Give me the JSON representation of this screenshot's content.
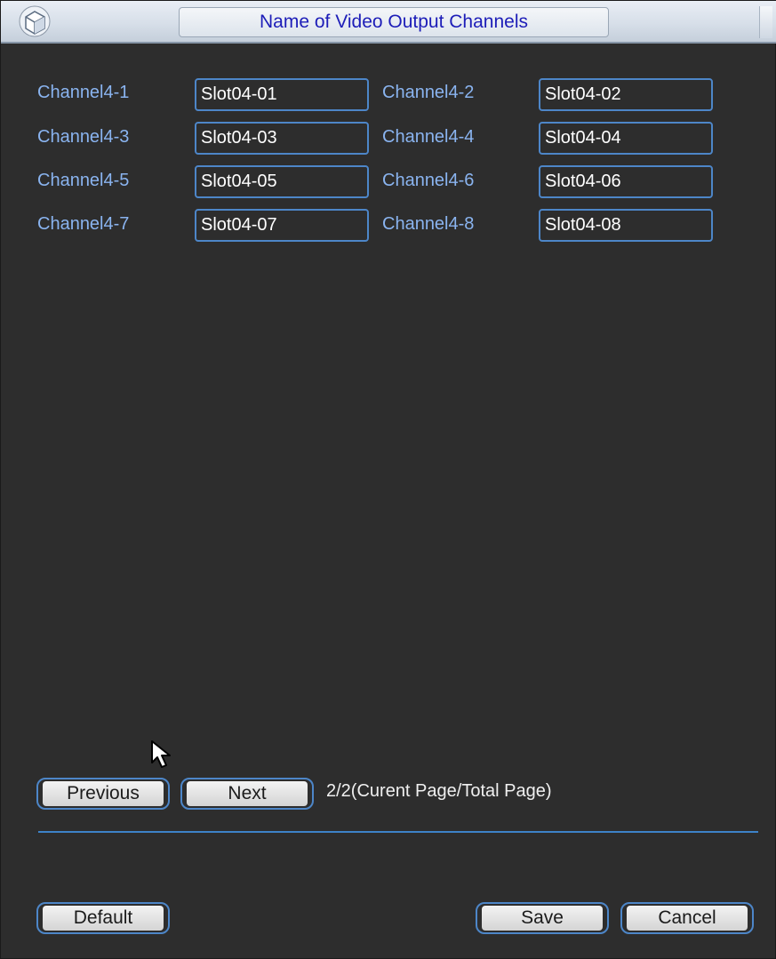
{
  "window": {
    "title": "Name of Video Output Channels",
    "icon": "app-cube-icon"
  },
  "channels": [
    {
      "label": "Channel4-1",
      "value": "Slot04-01"
    },
    {
      "label": "Channel4-2",
      "value": "Slot04-02"
    },
    {
      "label": "Channel4-3",
      "value": "Slot04-03"
    },
    {
      "label": "Channel4-4",
      "value": "Slot04-04"
    },
    {
      "label": "Channel4-5",
      "value": "Slot04-05"
    },
    {
      "label": "Channel4-6",
      "value": "Slot04-06"
    },
    {
      "label": "Channel4-7",
      "value": "Slot04-07"
    },
    {
      "label": "Channel4-8",
      "value": "Slot04-08"
    }
  ],
  "pagination": {
    "previous_label": "Previous",
    "next_label": "Next",
    "page_info": "2/2(Curent Page/Total Page)"
  },
  "footer": {
    "default_label": "Default",
    "save_label": "Save",
    "cancel_label": "Cancel"
  },
  "colors": {
    "background": "#2d2d2d",
    "label": "#8ab4f0",
    "accent_border": "#4d86c8",
    "title_text": "#1d1db8"
  }
}
